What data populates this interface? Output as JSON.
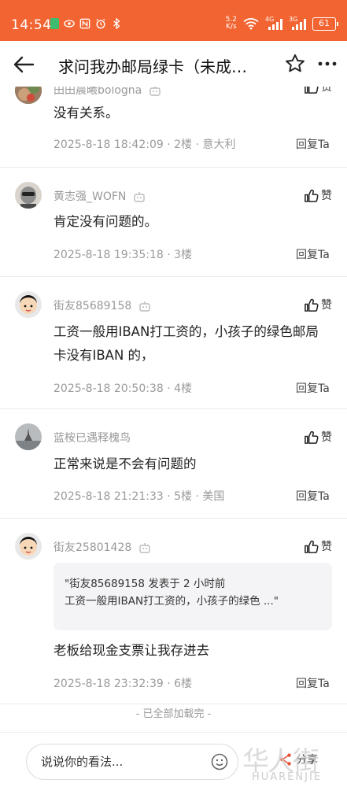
{
  "status_bar": {
    "time": "14:54",
    "net_speed_value": "5.2",
    "net_speed_unit": "K/s",
    "signal_1": "4G",
    "signal_2": "3G",
    "battery": "61"
  },
  "header": {
    "title": "求问我办邮局绿卡（未成…"
  },
  "comments": [
    {
      "username": "田田晨曦bologna",
      "like_label": "赞",
      "text": "没有关系。",
      "timestamp": "2025-8-18 18:42:09",
      "floor": "2楼",
      "location": "意大利",
      "reply_label": "回复Ta"
    },
    {
      "username": "黄志强_WOFN",
      "like_label": "赞",
      "text": "肯定没有问题的。",
      "timestamp": "2025-8-18 19:35:18",
      "floor": "3楼",
      "location": "",
      "reply_label": "回复Ta"
    },
    {
      "username": "街友85689158",
      "like_label": "赞",
      "text": "工资一般用IBAN打工资的，小孩子的绿色邮局卡没有IBAN 的，",
      "timestamp": "2025-8-18 20:50:38",
      "floor": "4楼",
      "location": "",
      "reply_label": "回复Ta"
    },
    {
      "username": "蓝桉已遇释槐鸟",
      "like_label": "赞",
      "text": "正常来说是不会有问题的",
      "timestamp": "2025-8-18 21:21:33",
      "floor": "5楼",
      "location": "美国",
      "reply_label": "回复Ta"
    },
    {
      "username": "街友25801428",
      "like_label": "赞",
      "quote_line1": "\"街友85689158 发表于 2 小时前",
      "quote_line2": "工资一般用IBAN打工资的，小孩子的绿色 ...\"",
      "text": "老板给现金支票让我存进去",
      "timestamp": "2025-8-18 23:32:39",
      "floor": "6楼",
      "location": "",
      "reply_label": "回复Ta"
    }
  ],
  "end_text": "- 已全部加载完 -",
  "bottom_bar": {
    "input_placeholder": "说说你的看法...",
    "share_label": "分享"
  },
  "watermark": {
    "cn": "华人街",
    "en": "HUARENJIE"
  },
  "colors": {
    "status_bar": "#f26431",
    "meta_text": "#9a9a9a"
  }
}
